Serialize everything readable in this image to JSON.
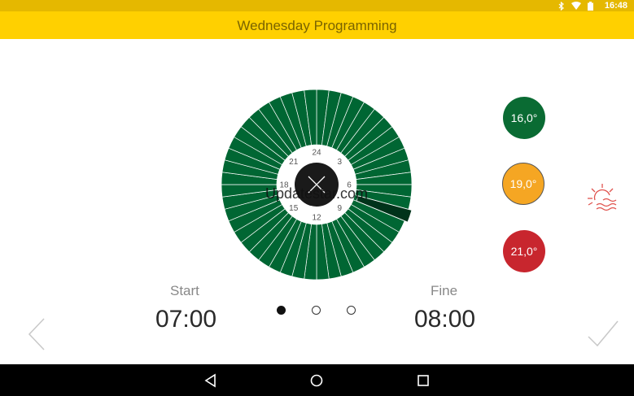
{
  "status_bar": {
    "time": "16:48",
    "icons": [
      "bluetooth-icon",
      "wifi-icon",
      "battery-icon"
    ]
  },
  "header": {
    "title": "Wednesday Programming"
  },
  "dial": {
    "segments": 48,
    "segment_color": "#006633",
    "selected_segment_color": "#00331a",
    "selected_segment_index": 14,
    "hour_labels": [
      "24",
      "3",
      "6",
      "9",
      "12",
      "15",
      "18",
      "21"
    ],
    "center_icon": "close-icon",
    "watermark": "Updatestar.com"
  },
  "temperatures": [
    {
      "label": "16,0°",
      "color": "#0a6b33"
    },
    {
      "label": "19,0°",
      "color": "#f5a623"
    },
    {
      "label": "21,0°",
      "color": "#c8262e"
    }
  ],
  "side_icon": "sun-heat-icon",
  "start": {
    "label": "Start",
    "value": "07:00"
  },
  "end": {
    "label": "Fine",
    "value": "08:00"
  },
  "pager": {
    "count": 3,
    "active_index": 0
  },
  "colors": {
    "status_bar": "#e5b800",
    "title_bar": "#ffd000",
    "title_text": "#7a6400",
    "accent_red": "#e0534e"
  },
  "navigation": [
    "back-icon",
    "home-icon",
    "recents-icon"
  ]
}
